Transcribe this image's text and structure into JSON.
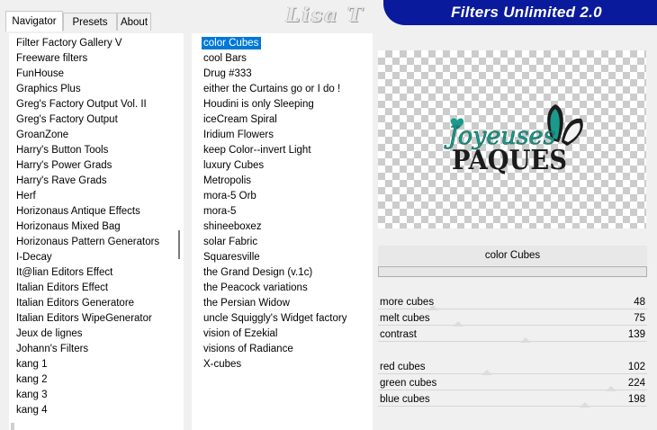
{
  "watermark": "Lisa T",
  "app": {
    "title": "Filters Unlimited 2.0"
  },
  "tabs": [
    {
      "label": "Navigator",
      "active": true
    },
    {
      "label": "Presets",
      "active": false
    },
    {
      "label": "About",
      "active": false
    }
  ],
  "categories": [
    "Filter Factory Gallery V",
    "Freeware filters",
    "FunHouse",
    "Graphics Plus",
    "Greg's Factory Output Vol. II",
    "Greg's Factory Output",
    "GroanZone",
    "Harry's Button Tools",
    "Harry's Power Grads",
    "Harry's Rave Grads",
    "Herf",
    "Horizonaus Antique Effects",
    "Horizonaus Mixed Bag",
    "Horizonaus Pattern Generators",
    "I-Decay",
    "It@lian Editors Effect",
    "Italian Editors Effect",
    "Italian Editors Generatore",
    "Italian Editors WipeGenerator",
    "Jeux de lignes",
    "Johann's Filters",
    "kang 1",
    "kang 2",
    "kang 3",
    "kang 4"
  ],
  "filters": [
    "color Cubes",
    "cool Bars",
    "Drug #333",
    "either the Curtains go or I do !",
    "Houdini is only Sleeping",
    "iceCream Spiral",
    "Iridium Flowers",
    "keep Color--invert Light",
    "luxury Cubes",
    "Metropolis",
    "mora-5 Orb",
    "mora-5",
    "shineeboxez",
    "solar Fabric",
    "Squaresville",
    "the Grand Design      (v.1c)",
    "the Peacock variations",
    "the Persian Widow",
    "uncle Squiggly's Widget factory",
    "vision of Ezekial",
    "visions of Radiance",
    "X-cubes"
  ],
  "selected_filter": "color Cubes",
  "preview": {
    "line1": "Joyeuses",
    "line2": "PAQUES",
    "colors": {
      "teal": "#1a9a8a",
      "dark": "#1c1c1c"
    }
  },
  "params": [
    {
      "name": "more cubes",
      "value": "48",
      "level": 0.19
    },
    {
      "name": "melt cubes",
      "value": "75",
      "level": 0.29
    },
    {
      "name": "contrast",
      "value": "139",
      "level": 0.55
    },
    {
      "name": "red cubes",
      "value": "102",
      "level": 0.4
    },
    {
      "name": "green cubes",
      "value": "224",
      "level": 0.88
    },
    {
      "name": "blue cubes",
      "value": "198",
      "level": 0.78
    }
  ],
  "colors": {
    "banner": "#0a1a9c",
    "selection": "#0078d7"
  }
}
